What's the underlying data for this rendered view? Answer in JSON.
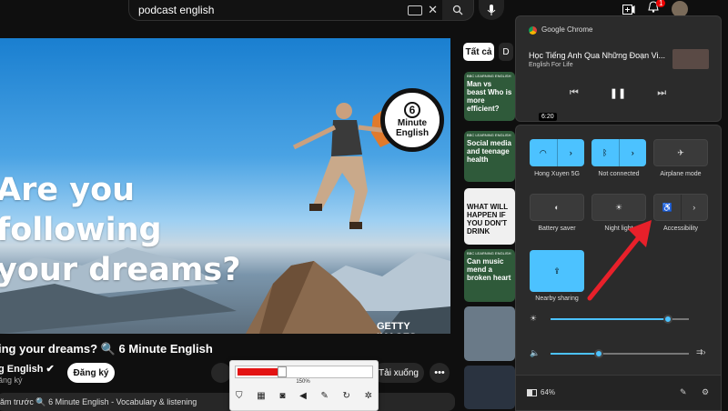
{
  "search": {
    "query": "podcast english"
  },
  "notifications": {
    "count": "1"
  },
  "video": {
    "overlay_title_lines": [
      "Are you",
      "following",
      "your dreams?"
    ],
    "badge_number": "6",
    "badge_text": "Minute English",
    "credit": "GETTY IMAGES",
    "heading": "ing your dreams? 🔍 6 Minute English",
    "channel": "g English ✔",
    "channel_sub": "ăng ký",
    "subscribe_label": "Đăng ký",
    "download_label": "Tải xuống",
    "description": "ăm trước  🔍 6 Minute English - Vocabulary & listening"
  },
  "zoom_popup": {
    "percent_label": "150%",
    "level": 0.3,
    "fill_color": "#e31313"
  },
  "filters": {
    "all": "Tất cả",
    "second": "D"
  },
  "suggestions": [
    {
      "title": "Man vs beast Who is more efficient?",
      "style": "green"
    },
    {
      "title": "Social media and teenage health",
      "style": "green"
    },
    {
      "title": "WHAT WILL HAPPEN IF YOU DON'T DRINK",
      "style": "white"
    },
    {
      "title": "Can music mend a broken heart",
      "style": "green"
    }
  ],
  "bbc_tag": "BBC LEARNING ENGLISH",
  "media": {
    "source": "Google Chrome",
    "title": "Học Tiếng Anh Qua Những Đoạn Vi...",
    "artist": "English For Life",
    "time_chip": "6:20"
  },
  "quick_settings": {
    "tiles": [
      {
        "label": "Hong Xuyen 5G",
        "icon": "wifi-icon",
        "on": true,
        "expandable": true
      },
      {
        "label": "Not connected",
        "icon": "bluetooth-icon",
        "on": true,
        "expandable": true
      },
      {
        "label": "Airplane mode",
        "icon": "airplane-icon",
        "on": false,
        "expandable": false
      },
      {
        "label": "Battery saver",
        "icon": "battery-saver-icon",
        "on": false,
        "expandable": false
      },
      {
        "label": "Night light",
        "icon": "night-light-icon",
        "on": false,
        "expandable": false
      },
      {
        "label": "Accessibility",
        "icon": "accessibility-icon",
        "on": false,
        "expandable": true
      },
      {
        "label": "Nearby sharing",
        "icon": "nearby-sharing-icon",
        "on": true,
        "expandable": false
      }
    ],
    "brightness_level": 0.85,
    "volume_level": 0.35,
    "battery_percent": "64%",
    "accent_color": "#4cc2ff"
  },
  "annotation": {
    "arrow_color": "#e8202a"
  }
}
